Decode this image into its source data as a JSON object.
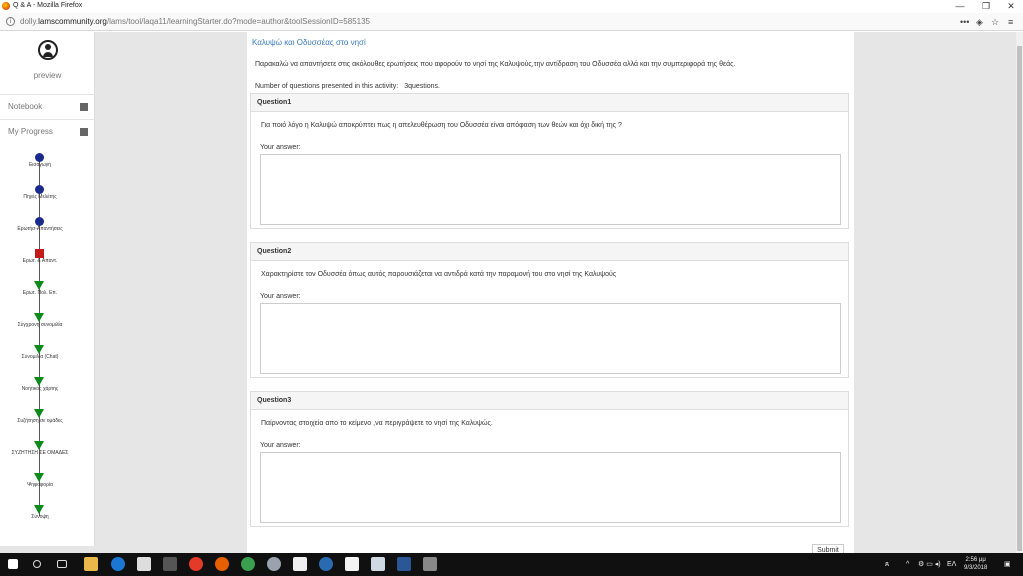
{
  "window": {
    "title": "Q & A - Mozilla Firefox",
    "controls": [
      "—",
      "❐",
      "✕"
    ]
  },
  "browser": {
    "url_prefix": "dolly.",
    "url_domain": "lamscommunity.org",
    "url_rest": "/lams/tool/laqa11/learningStarter.do?mode=author&toolSessionID=585135",
    "icons": [
      "more-icon",
      "pocket-icon",
      "bookmark-star-icon",
      "menu-icon"
    ]
  },
  "sidebar": {
    "preview_label": "preview",
    "notebook_label": "Notebook",
    "progress_label": "My Progress",
    "steps": [
      {
        "label": "Εισαγωγή",
        "status": "completed"
      },
      {
        "label": "Πηγές Μελέτης",
        "status": "completed"
      },
      {
        "label": "Ερωτήσ-Απαντήσεις",
        "status": "completed"
      },
      {
        "label": "Ερωτ. & Απαντ.",
        "status": "current"
      },
      {
        "label": "Ερωτ. Πολ. Επ.",
        "status": "upcoming"
      },
      {
        "label": "Σύγχρονη συνομιλία",
        "status": "upcoming"
      },
      {
        "label": "Συνομιλία (Chat)",
        "status": "upcoming"
      },
      {
        "label": "Νοητικός χάρτης",
        "status": "upcoming"
      },
      {
        "label": "Συζήτηση σε ομάδες",
        "status": "upcoming"
      },
      {
        "label": "ΣΥΖΗΤΗΣΗ ΣΕ ΟΜΑΔΕΣ",
        "status": "upcoming"
      },
      {
        "label": "Ψηφοφορία",
        "status": "upcoming"
      },
      {
        "label": "Σύνοψη",
        "status": "upcoming"
      }
    ]
  },
  "activity": {
    "title": "Καλυψώ και Οδυσσέας στο νησί",
    "instructions": "Παρακαλώ να απαντήσετε στις ακόλουθες ερωτήσεις που αφορούν το νησί της Καλυψούς,την αντίδραση του Οδυσσέα αλλά και την συμπεριφορά της θεάς.",
    "num_questions_label": "Number of questions presented in this activity:",
    "num_questions_value": "3questions."
  },
  "questions": [
    {
      "header": "Question1",
      "text": "Για ποιό λόγο η Καλυψώ αποκρύπτει πως η απελευθέρωση του Οδυσσέα είναι απόφαση των θεών και όχι δική της ?",
      "answer_label": "Your answer:",
      "answer": ""
    },
    {
      "header": "Question2",
      "text": "Χαρακτηρίστε τον Οδυσσέα όπως αυτός παρουσιάζεται να αντιδρά κατά την  παραμονή του στο νησί της Καλυψούς",
      "answer_label": "Your answer:",
      "answer": ""
    },
    {
      "header": "Question3",
      "text": "Παίρνοντας στοιχεία απο το κείμενο ,να περιγράψετε το νησί της Καλυψώς.",
      "answer_label": "Your answer:",
      "answer": ""
    }
  ],
  "submit_label": "Submit",
  "taskbar": {
    "apps": [
      "start-icon",
      "search-icon",
      "task-view-icon",
      "file-explorer-icon",
      "edge-icon",
      "store-icon",
      "app-icon",
      "chrome-icon",
      "firefox-icon",
      "app2-icon",
      "app3-icon",
      "mail-icon",
      "network-icon",
      "writer-icon",
      "app4-icon",
      "word-icon",
      "app5-icon"
    ],
    "lang": "ΕΛ",
    "time": "2:56 μμ",
    "date": "9/3/2018"
  },
  "colors": {
    "completed": "#1a2a8c",
    "current": "#c31a1a",
    "upcoming": "#0a8a1a",
    "link": "#3a7bbf"
  }
}
